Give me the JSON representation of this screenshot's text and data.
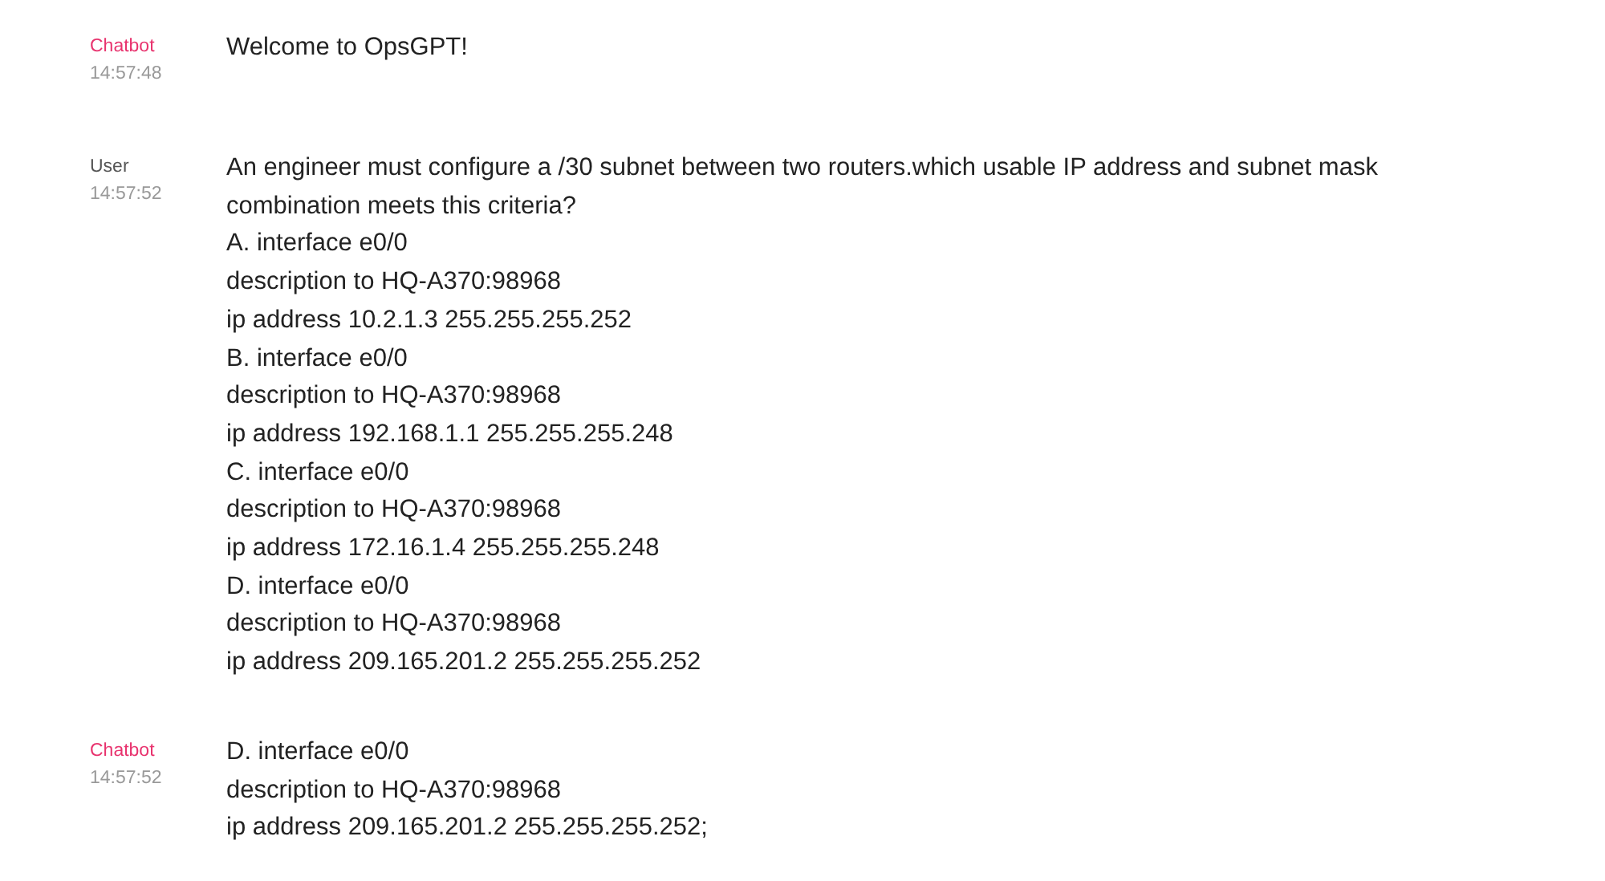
{
  "messages": [
    {
      "kind": "bot",
      "sender": "Chatbot",
      "time": "14:57:48",
      "lines": [
        "Welcome to OpsGPT!"
      ]
    },
    {
      "kind": "user",
      "sender": "User",
      "time": "14:57:52",
      "lines": [
        "An engineer must configure a /30 subnet between two routers.which usable IP address and subnet mask combination meets this criteria?",
        "A. interface e0/0",
        "description to HQ-A370:98968",
        "ip address 10.2.1.3 255.255.255.252",
        "B. interface e0/0",
        "description to HQ-A370:98968",
        "ip address 192.168.1.1 255.255.255.248",
        "C. interface e0/0",
        "description to HQ-A370:98968",
        "ip address 172.16.1.4 255.255.255.248",
        "D. interface e0/0",
        "description to HQ-A370:98968",
        "ip address 209.165.201.2 255.255.255.252"
      ]
    },
    {
      "kind": "bot",
      "sender": "Chatbot",
      "time": "14:57:52",
      "lines": [
        "D. interface e0/0",
        "description to HQ-A370:98968",
        "ip address 209.165.201.2 255.255.255.252;"
      ]
    }
  ]
}
